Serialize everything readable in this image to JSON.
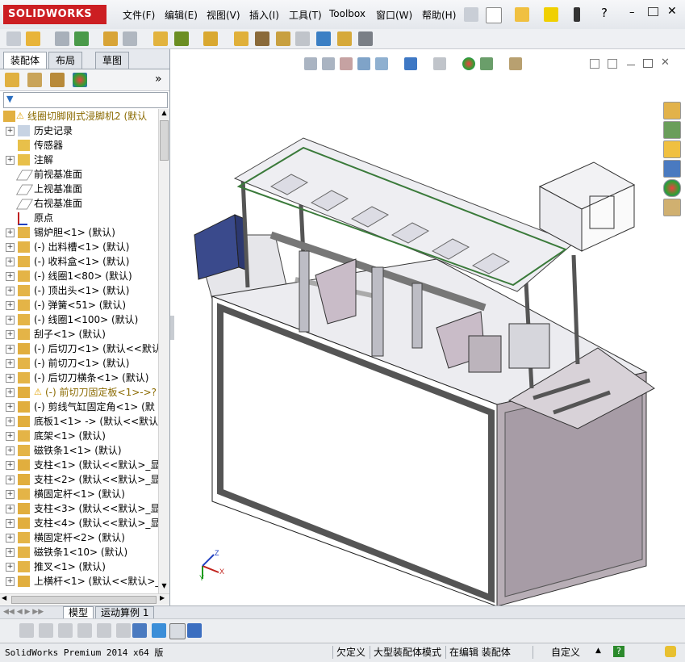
{
  "app": {
    "logo": "SOLIDWORKS",
    "brand_color": "#cc1e22"
  },
  "menu": {
    "items": [
      "文件(F)",
      "编辑(E)",
      "视图(V)",
      "插入(I)",
      "工具(T)",
      "Toolbox",
      "窗口(W)",
      "帮助(H)"
    ]
  },
  "left_panel": {
    "tabs": [
      "装配体",
      "布局",
      "草图"
    ],
    "filter_icon": "filter-icon",
    "tree": [
      {
        "label": "线圈切脚刚式浸脚机2   (默认",
        "icon": "assembly-warning-icon",
        "expand": false,
        "top": true
      },
      {
        "label": "历史记录",
        "icon": "history-icon",
        "expand": true
      },
      {
        "label": "传感器",
        "icon": "sensor-icon",
        "expand": false
      },
      {
        "label": "注解",
        "icon": "annotation-icon",
        "expand": true
      },
      {
        "label": "前视基准面",
        "icon": "plane-icon",
        "expand": false
      },
      {
        "label": "上视基准面",
        "icon": "plane-icon",
        "expand": false
      },
      {
        "label": "右视基准面",
        "icon": "plane-icon",
        "expand": false
      },
      {
        "label": "原点",
        "icon": "origin-icon",
        "expand": false
      },
      {
        "label": "锡炉胆<1> (默认)",
        "icon": "subassembly-icon",
        "expand": true
      },
      {
        "label": "(-) 出料槽<1> (默认)",
        "icon": "subassembly-icon",
        "expand": true
      },
      {
        "label": "(-) 收料盒<1> (默认)",
        "icon": "subassembly-icon",
        "expand": true
      },
      {
        "label": "(-) 线圈1<80> (默认)",
        "icon": "subassembly-icon",
        "expand": true
      },
      {
        "label": "(-) 顶出头<1> (默认)",
        "icon": "subassembly-icon",
        "expand": true
      },
      {
        "label": "(-) 弹簧<51> (默认)",
        "icon": "subassembly-icon",
        "expand": true
      },
      {
        "label": "(-) 线圈1<100> (默认)",
        "icon": "subassembly-icon",
        "expand": true
      },
      {
        "label": "刮子<1> (默认)",
        "icon": "subassembly-icon",
        "expand": true
      },
      {
        "label": "(-) 后切刀<1> (默认<<默认",
        "icon": "part-icon",
        "expand": true
      },
      {
        "label": "(-) 前切刀<1> (默认)",
        "icon": "subassembly-icon",
        "expand": true
      },
      {
        "label": "(-) 后切刀横条<1> (默认)",
        "icon": "subassembly-icon",
        "expand": true
      },
      {
        "label": "(-) 前切刀固定板<1>->?",
        "icon": "part-warning-icon",
        "expand": true,
        "warn": true
      },
      {
        "label": "(-) 剪线气缸固定角<1> (默",
        "icon": "part-icon",
        "expand": true
      },
      {
        "label": "底板1<1> -> (默认<<默认>_",
        "icon": "part-icon",
        "expand": true
      },
      {
        "label": "底架<1> (默认)",
        "icon": "subassembly-icon",
        "expand": true
      },
      {
        "label": "磁铁条1<1> (默认)",
        "icon": "subassembly-icon",
        "expand": true
      },
      {
        "label": "支柱<1> (默认<<默认>_显示",
        "icon": "part-icon",
        "expand": true
      },
      {
        "label": "支柱<2> (默认<<默认>_显示",
        "icon": "part-icon",
        "expand": true
      },
      {
        "label": "横固定杆<1> (默认)",
        "icon": "subassembly-icon",
        "expand": true
      },
      {
        "label": "支柱<3> (默认<<默认>_显示",
        "icon": "part-icon",
        "expand": true
      },
      {
        "label": "支柱<4> (默认<<默认>_显示",
        "icon": "part-icon",
        "expand": true
      },
      {
        "label": "横固定杆<2> (默认)",
        "icon": "subassembly-icon",
        "expand": true
      },
      {
        "label": "磁铁条1<10> (默认)",
        "icon": "subassembly-icon",
        "expand": true
      },
      {
        "label": "推叉<1> (默认)",
        "icon": "subassembly-icon",
        "expand": true
      },
      {
        "label": "上横杆<1> (默认<<默认>_显",
        "icon": "part-icon",
        "expand": true
      }
    ]
  },
  "bottom_tabs": [
    "模型",
    "运动算例 1"
  ],
  "status": {
    "product": "SolidWorks Premium 2014 x64 版",
    "segments": [
      "欠定义",
      "大型装配体模式",
      "在编辑 装配体",
      "自定义"
    ]
  }
}
